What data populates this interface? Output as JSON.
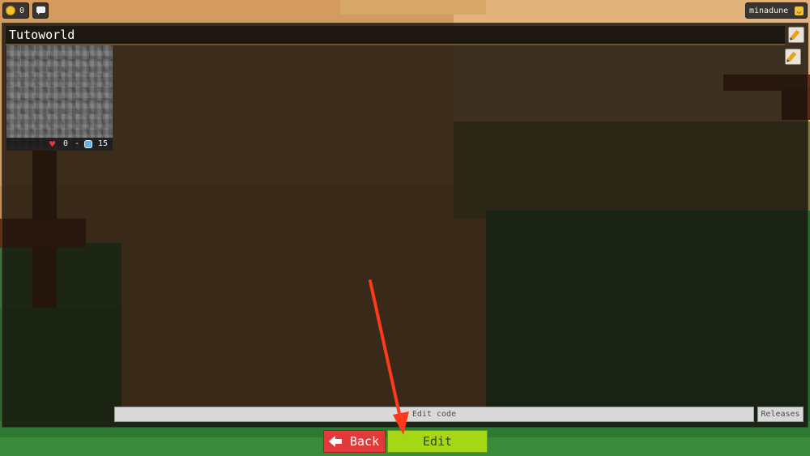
{
  "topbar": {
    "coins": "0",
    "username": "minadune",
    "coin_icon": "coin-icon",
    "chat_icon": "chat-icon",
    "avatar_icon": "smile-icon"
  },
  "world": {
    "title": "Tutoworld",
    "likes": "0",
    "separator": "-",
    "visits": "15"
  },
  "actions": {
    "edit_code_label": "Edit code",
    "releases_label": "Releases",
    "back_label": "Back",
    "edit_label": "Edit"
  },
  "colors": {
    "back_button": "#e23a3a",
    "edit_button": "#a6d716",
    "tutorial_arrow": "#ff3a1a"
  }
}
